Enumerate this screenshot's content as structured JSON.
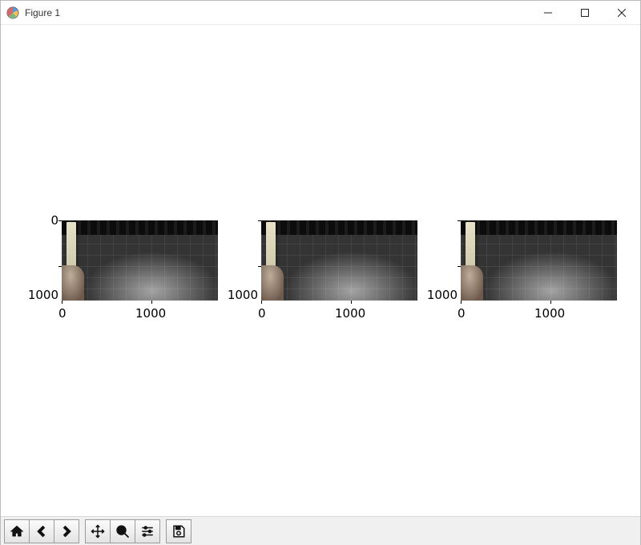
{
  "window": {
    "title": "Figure 1"
  },
  "toolbar": {
    "home": "Home",
    "back": "Back",
    "forward": "Forward",
    "pan": "Pan",
    "zoom": "Zoom",
    "configure": "Configure subplots",
    "save": "Save"
  },
  "chart_data": [
    {
      "type": "image",
      "xlim": [
        0,
        1750
      ],
      "ylim": [
        1080,
        0
      ],
      "xticks": [
        0,
        1000
      ],
      "yticks": [
        0,
        1000
      ],
      "title": "",
      "xlabel": "",
      "ylabel": ""
    },
    {
      "type": "image",
      "xlim": [
        0,
        1750
      ],
      "ylim": [
        1080,
        0
      ],
      "xticks": [
        0,
        1000
      ],
      "yticks": [
        0,
        1000
      ],
      "title": "",
      "xlabel": "",
      "ylabel": ""
    },
    {
      "type": "image",
      "xlim": [
        0,
        1750
      ],
      "ylim": [
        1080,
        0
      ],
      "xticks": [
        0,
        1000
      ],
      "yticks": [
        0,
        1000
      ],
      "title": "",
      "xlabel": "",
      "ylabel": ""
    }
  ]
}
